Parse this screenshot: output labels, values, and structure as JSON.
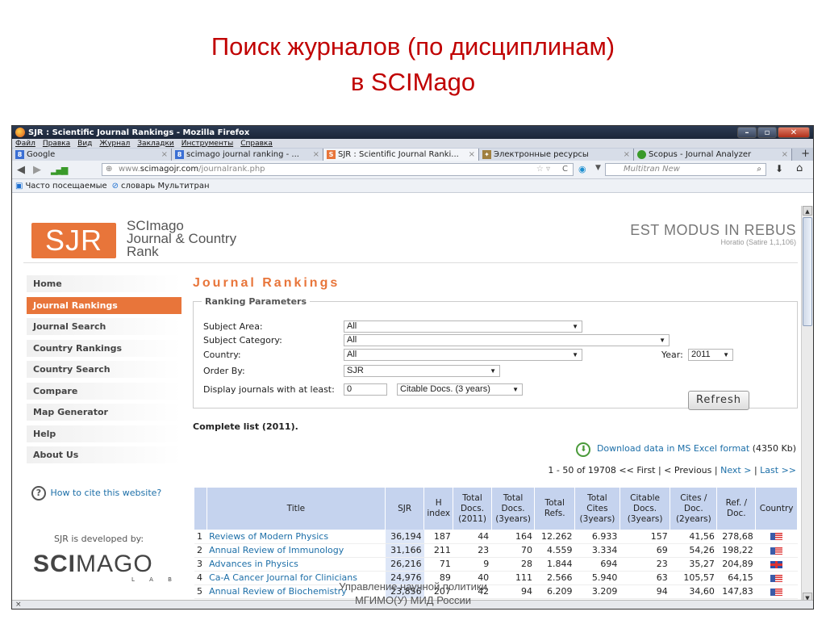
{
  "slide": {
    "title_line1": "Поиск журналов (по дисциплинам)",
    "title_line2": "в SCIMago",
    "footer_line1": "Управление научной политики",
    "footer_line2": "МГИМО(У) МИД России"
  },
  "browser": {
    "window_title": "SJR : Scientific Journal Rankings - Mozilla Firefox",
    "menu": [
      "Файл",
      "Правка",
      "Вид",
      "Журнал",
      "Закладки",
      "Инструменты",
      "Справка"
    ],
    "tabs": [
      {
        "label": "Google"
      },
      {
        "label": "scimago journal ranking - ..."
      },
      {
        "label": "SJR : Scientific Journal Ranki..."
      },
      {
        "label": "Электронные ресурсы"
      },
      {
        "label": "Scopus - Journal Analyzer"
      }
    ],
    "url_prefix": "www.",
    "url_domain": "scimagojr.com",
    "url_path": "/journalrank.php",
    "search_placeholder": "Multitran New",
    "bookmarks": [
      "Часто посещаемые",
      "словарь Мультитран"
    ]
  },
  "site": {
    "logo": "SJR",
    "brand_line1": "SCImago",
    "brand_line2": "Journal & Country",
    "brand_line3": "Rank",
    "motto": "EST MODUS IN REBUS",
    "motto_sub": "Horatio (Satire 1,1,106)",
    "nav": [
      "Home",
      "Journal Rankings",
      "Journal Search",
      "Country Rankings",
      "Country Search",
      "Compare",
      "Map Generator",
      "Help",
      "About Us"
    ],
    "cite_link": "How to cite this website?",
    "developed_by": "SJR is developed by:",
    "scimago_logo_a": "SCI",
    "scimago_logo_b": "MAGO",
    "scimago_lab": "L A B"
  },
  "rankings": {
    "title": "Journal Rankings",
    "params_legend": "Ranking Parameters",
    "subject_area_label": "Subject Area:",
    "subject_area_value": "All",
    "subject_category_label": "Subject Category:",
    "subject_category_value": "All",
    "country_label": "Country:",
    "country_value": "All",
    "year_label": "Year:",
    "year_value": "2011",
    "order_label": "Order By:",
    "order_value": "SJR",
    "display_label": "Display journals with at least:",
    "display_value": "0",
    "display_type": "Citable Docs. (3 years)",
    "refresh": "Refresh",
    "complete_list": "Complete list (2011).",
    "download_link": "Download data in MS Excel format",
    "download_size": "(4350 Kb)",
    "pagination_prefix": "1 - 50 of 19708 << First | < Previous |",
    "next": "Next >",
    "sep": "|",
    "last": "Last >>"
  },
  "table": {
    "headers": [
      "",
      "Title",
      "SJR",
      "H index",
      "Total Docs. (2011)",
      "Total Docs. (3years)",
      "Total Refs.",
      "Total Cites (3years)",
      "Citable Docs. (3years)",
      "Cites / Doc. (2years)",
      "Ref. / Doc.",
      "Country"
    ],
    "rows": [
      {
        "i": "1",
        "title": "Reviews of Modern Physics",
        "sjr": "36,194",
        "h": "187",
        "td": "44",
        "td3": "164",
        "tr": "12.262",
        "tc3": "6.933",
        "cd3": "157",
        "cpd": "41,56",
        "rpd": "278,68",
        "country": "us"
      },
      {
        "i": "2",
        "title": "Annual Review of Immunology",
        "sjr": "31,166",
        "h": "211",
        "td": "23",
        "td3": "70",
        "tr": "4.559",
        "tc3": "3.334",
        "cd3": "69",
        "cpd": "54,26",
        "rpd": "198,22",
        "country": "us"
      },
      {
        "i": "3",
        "title": "Advances in Physics",
        "sjr": "26,216",
        "h": "71",
        "td": "9",
        "td3": "28",
        "tr": "1.844",
        "tc3": "694",
        "cd3": "23",
        "cpd": "35,27",
        "rpd": "204,89",
        "country": "gb"
      },
      {
        "i": "4",
        "title": "Ca-A Cancer Journal for Clinicians",
        "sjr": "24,976",
        "h": "89",
        "td": "40",
        "td3": "111",
        "tr": "2.566",
        "tc3": "5.940",
        "cd3": "63",
        "cpd": "105,57",
        "rpd": "64,15",
        "country": "us"
      },
      {
        "i": "5",
        "title": "Annual Review of Biochemistry",
        "sjr": "23,856",
        "h": "207",
        "td": "42",
        "td3": "94",
        "tr": "6.209",
        "tc3": "3.209",
        "cd3": "94",
        "cpd": "34,60",
        "rpd": "147,83",
        "country": "us"
      }
    ]
  },
  "status": {
    "text": "×"
  }
}
